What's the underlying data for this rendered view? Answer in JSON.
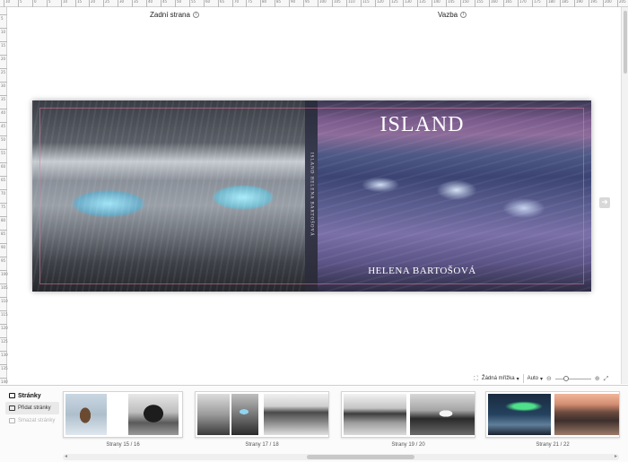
{
  "ruler": {
    "top_numbers": [
      "10",
      "5",
      "0",
      "5",
      "10",
      "15",
      "20",
      "25",
      "30",
      "35",
      "40",
      "45",
      "50",
      "55",
      "60",
      "65",
      "70",
      "75",
      "80",
      "85",
      "90",
      "95",
      "100",
      "105",
      "110",
      "115",
      "120",
      "125",
      "130",
      "135",
      "140",
      "145",
      "150",
      "155",
      "160",
      "165",
      "170",
      "175",
      "180",
      "185",
      "190",
      "195",
      "200",
      "205"
    ],
    "left_numbers": [
      "5",
      "10",
      "15",
      "20",
      "25",
      "30",
      "35",
      "40",
      "45",
      "50",
      "55",
      "60",
      "65",
      "70",
      "75",
      "80",
      "85",
      "90",
      "95",
      "100",
      "105",
      "110",
      "115",
      "120",
      "125",
      "130",
      "135",
      "140"
    ]
  },
  "sections": {
    "back_label": "Zadní strana",
    "spine_label": "Vazba"
  },
  "cover": {
    "front_title": "ISLAND",
    "author": "HELENA BARTOŠOVÁ",
    "spine_text": "ISLAND   HELENA BARTOŠOVÁ"
  },
  "zoombar": {
    "mirror_label": "Žádná mřížka",
    "zoom_value": "Auto",
    "zoom_level": 0.25
  },
  "sidebar": {
    "title": "Stránky",
    "add_pages": "Přidat stránky",
    "remove_pages": "Smazat stránky"
  },
  "spreads": [
    {
      "label": "Strany 15 / 16"
    },
    {
      "label": "Strany 17 / 18"
    },
    {
      "label": "Strany 19 / 20"
    },
    {
      "label": "Strany 21 / 22"
    }
  ],
  "colors": {
    "accent_trim": "#e678a0",
    "panel_bg": "#fbfbfb"
  }
}
